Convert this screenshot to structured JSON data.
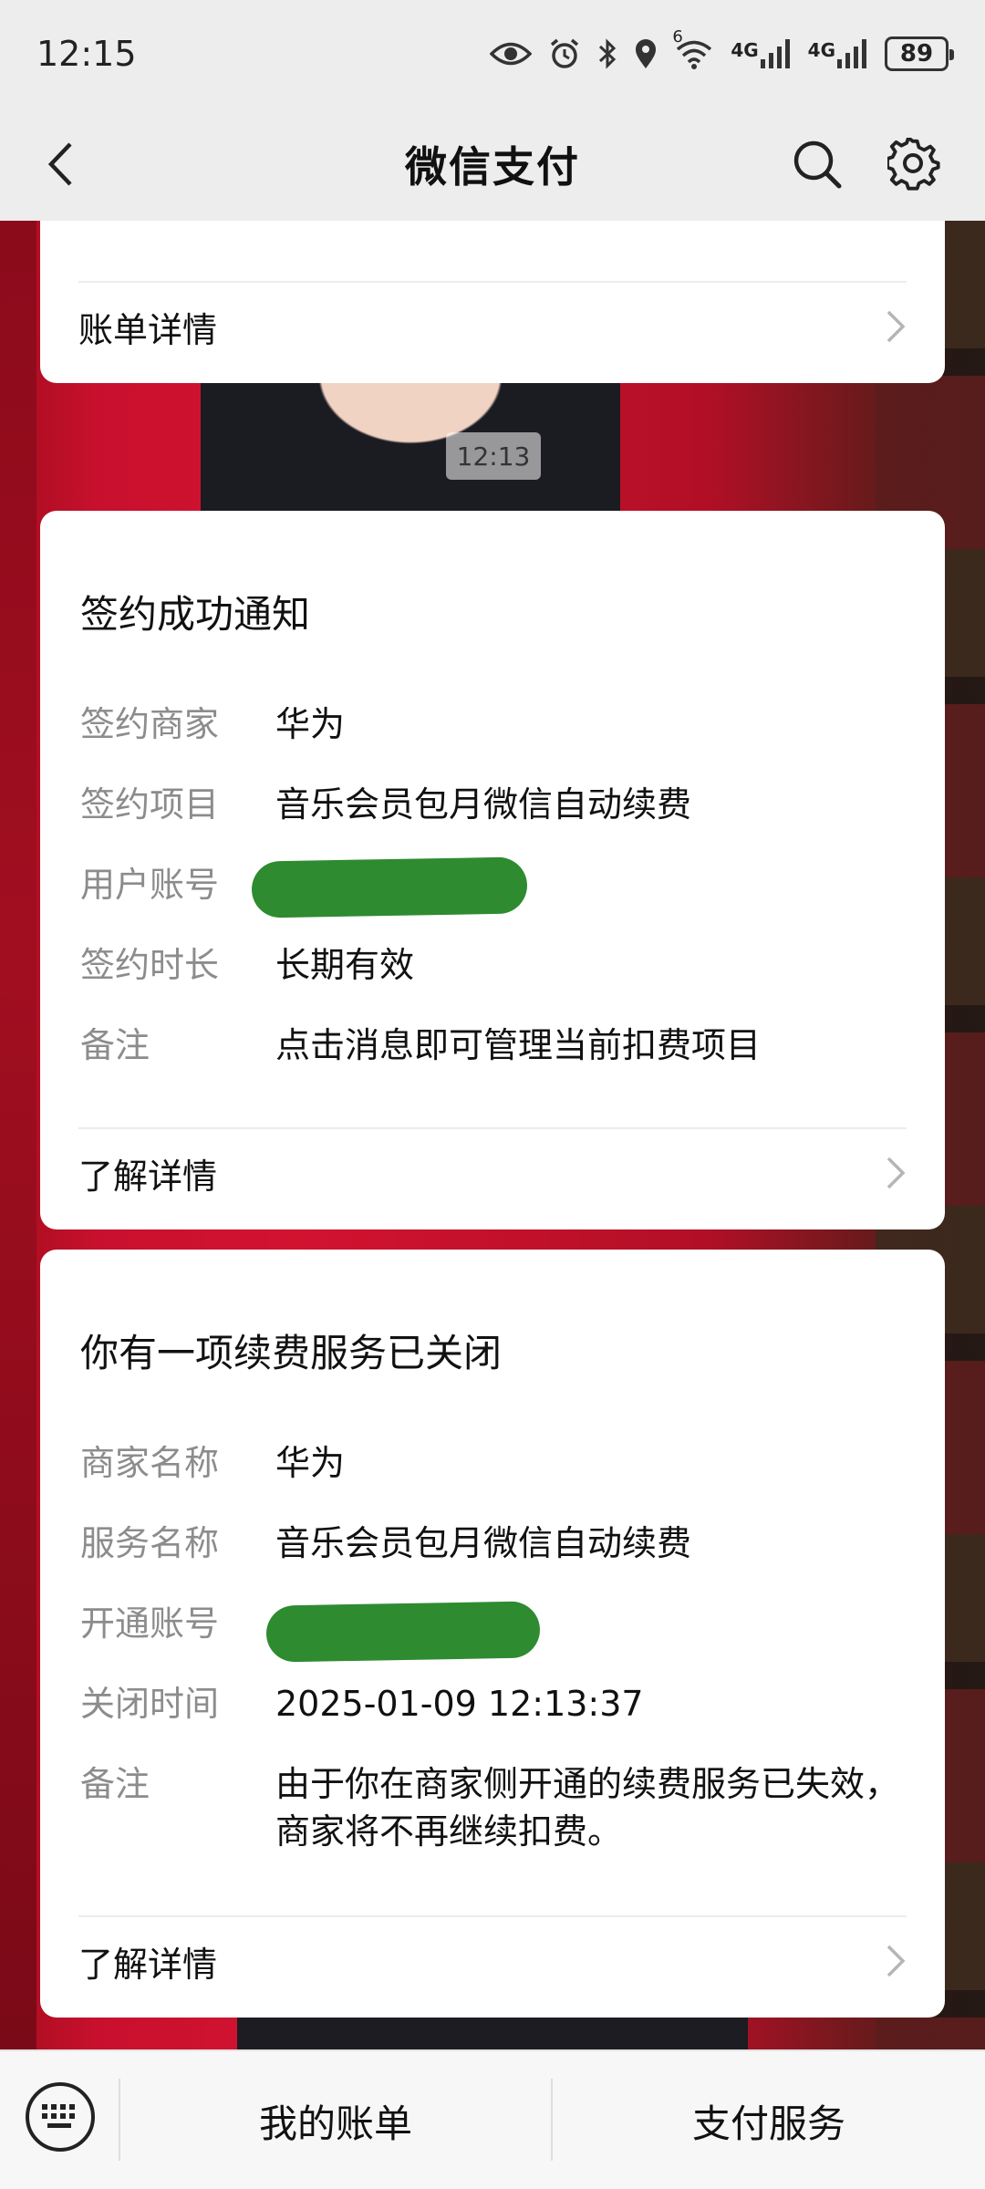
{
  "status_bar": {
    "time": "12:15",
    "network_1": "4G",
    "network_2": "4G",
    "wifi_badge": "6",
    "battery": "89"
  },
  "header": {
    "title": "微信支付"
  },
  "top_card": {
    "link_label": "账单详情"
  },
  "timestamp": "12:13",
  "sign_card": {
    "heading": "签约成功通知",
    "rows": [
      {
        "key": "签约商家",
        "value": "华为"
      },
      {
        "key": "签约项目",
        "value": "音乐会员包月微信自动续费"
      },
      {
        "key": "用户账号",
        "value": ""
      },
      {
        "key": "签约时长",
        "value": "长期有效"
      },
      {
        "key": "备注",
        "value": "点击消息即可管理当前扣费项目"
      }
    ],
    "link_label": "了解详情"
  },
  "close_card": {
    "heading": "你有一项续费服务已关闭",
    "rows": [
      {
        "key": "商家名称",
        "value": "华为"
      },
      {
        "key": "服务名称",
        "value": "音乐会员包月微信自动续费"
      },
      {
        "key": "开通账号",
        "value": ""
      },
      {
        "key": "关闭时间",
        "value": "2025-01-09 12:13:37"
      },
      {
        "key": "备注",
        "value": "由于你在商家侧开通的续费服务已失效，商家将不再继续扣费。"
      }
    ],
    "link_label": "了解详情"
  },
  "bottom_bar": {
    "tab_bills": "我的账单",
    "tab_services": "支付服务"
  },
  "colors": {
    "header_bg": "#ededed",
    "card_bg": "#ffffff",
    "key_text": "#8c8c8c",
    "redaction": "#2e8b30"
  }
}
